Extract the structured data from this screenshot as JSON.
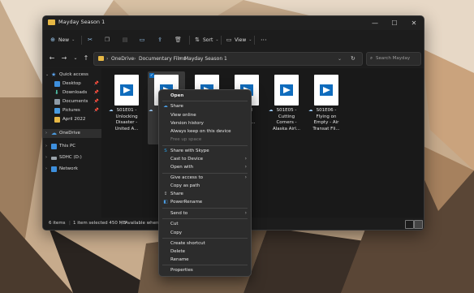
{
  "window": {
    "title": "Mayday Season 1"
  },
  "commandbar": {
    "new_label": "New",
    "sort_label": "Sort",
    "view_label": "View",
    "more": "···"
  },
  "navbar": {
    "breadcrumb": [
      "OneDrive",
      "Documentary Films",
      "Mayday Season 1"
    ],
    "search_placeholder": "Search Mayday Se..."
  },
  "sidebar": {
    "items": [
      {
        "label": "Quick access"
      },
      {
        "label": "Desktop"
      },
      {
        "label": "Downloads"
      },
      {
        "label": "Documents"
      },
      {
        "label": "Pictures"
      },
      {
        "label": "April 2022"
      },
      {
        "label": "OneDrive"
      },
      {
        "label": "This PC"
      },
      {
        "label": "SDHC (D:)"
      },
      {
        "label": "Network"
      }
    ]
  },
  "files": [
    {
      "name": "S01E01 -\nUnlocking\nDisaster -\nUnited A..."
    },
    {
      "name": ""
    },
    {
      "name": ""
    },
    {
      "name": "Blind\npenl\n503 ..."
    },
    {
      "name": "S01E05 -\nCutting\nCorners -\nAlaska Airl..."
    },
    {
      "name": "S01E06 -\nFlying on\nEmpty - Air\nTransat Fli..."
    }
  ],
  "status": {
    "count": "6 items",
    "selected": "1 item selected 450 MB",
    "availability": "Available when o"
  },
  "context_menu": {
    "items": [
      "Open",
      "Share",
      "View online",
      "Version history",
      "Always keep on this device",
      "Free up space",
      "Share with Skype",
      "Cast to Device",
      "Open with",
      "Give access to",
      "Copy as path",
      "Share",
      "PowerRename",
      "Send to",
      "Cut",
      "Copy",
      "Create shortcut",
      "Delete",
      "Rename",
      "Properties"
    ]
  },
  "colors": {
    "accent": "#0f6cbd",
    "folder": "#e7b845"
  }
}
